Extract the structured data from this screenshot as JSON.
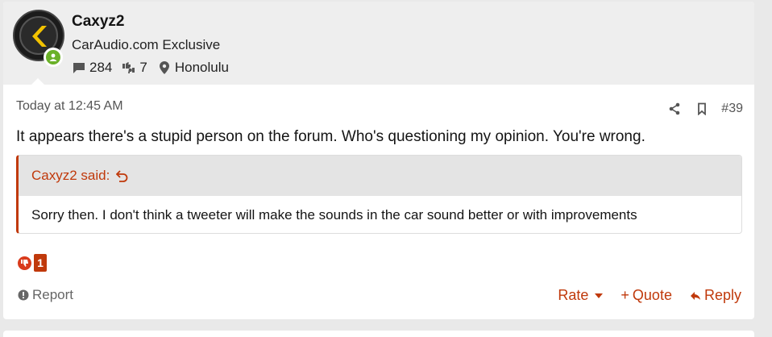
{
  "user": {
    "name": "Caxyz2",
    "title": "CarAudio.com Exclusive",
    "message_count": "284",
    "reaction_score": "7",
    "location": "Honolulu",
    "online": true,
    "avatar_accent": "#f2c200"
  },
  "post": {
    "date": "Today at 12:45 AM",
    "number": "#39",
    "text": "It appears there's a stupid person on the forum. Who's questioning my opinion. You're wrong."
  },
  "quote": {
    "author_label": "Caxyz2 said:",
    "text": "Sorry then. I don't think a tweeter will make the sounds in the car sound better or with improvements"
  },
  "reactions": {
    "icon": "thumbs-down-icon",
    "count": "1"
  },
  "footer": {
    "report_label": "Report",
    "rate_label": "Rate",
    "quote_label": "Quote",
    "reply_label": "Reply"
  },
  "colors": {
    "accent": "#c0390b",
    "online": "#6ab128",
    "header_bg": "#eeeeee",
    "quote_head_bg": "#e4e4e4"
  }
}
